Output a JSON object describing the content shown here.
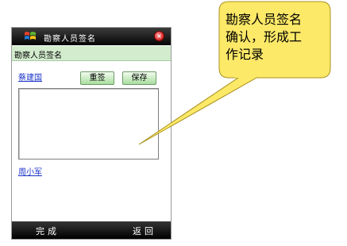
{
  "window": {
    "title": "勘察人员签名",
    "logo_icon": "windows-logo-icon",
    "close_icon": "close-icon"
  },
  "header": {
    "label": "勘察人员签名"
  },
  "form": {
    "signer1": "蔡建国",
    "signer2": "周小军",
    "resign_label": "重签",
    "save_label": "保存"
  },
  "softkeys": {
    "left": "完成",
    "right": "返回"
  },
  "callout": {
    "lines": [
      "勘察人员签名",
      "确认，形成工",
      "作记录"
    ],
    "fill_color": "#fde968",
    "border_color": "#a99220"
  },
  "colors": {
    "header_band": "#d3ecce",
    "button_bottom": "#a9dd9f",
    "link": "#1a33c8"
  }
}
